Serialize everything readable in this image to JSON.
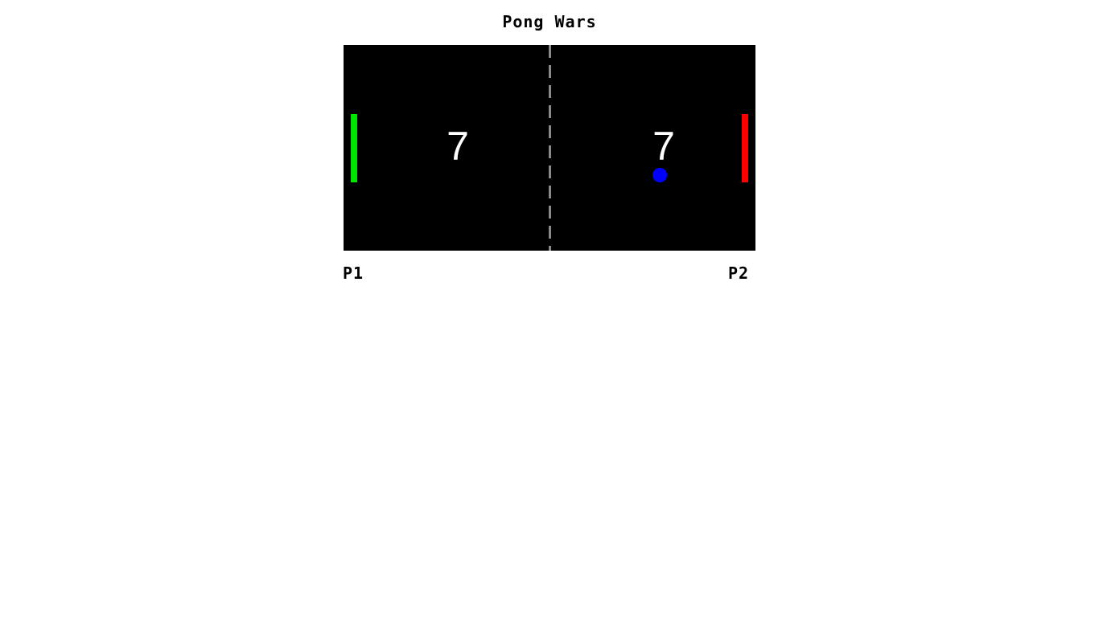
{
  "title": "Pong Wars",
  "scores": {
    "left": "7",
    "right": "7"
  },
  "players": {
    "left_label": "P1",
    "right_label": "P2"
  },
  "colors": {
    "court": "#000000",
    "net": "#8a8a8a",
    "left_paddle": "#00e600",
    "right_paddle": "#ff0000",
    "ball": "#0000ff",
    "score_text": "#ffffff"
  }
}
